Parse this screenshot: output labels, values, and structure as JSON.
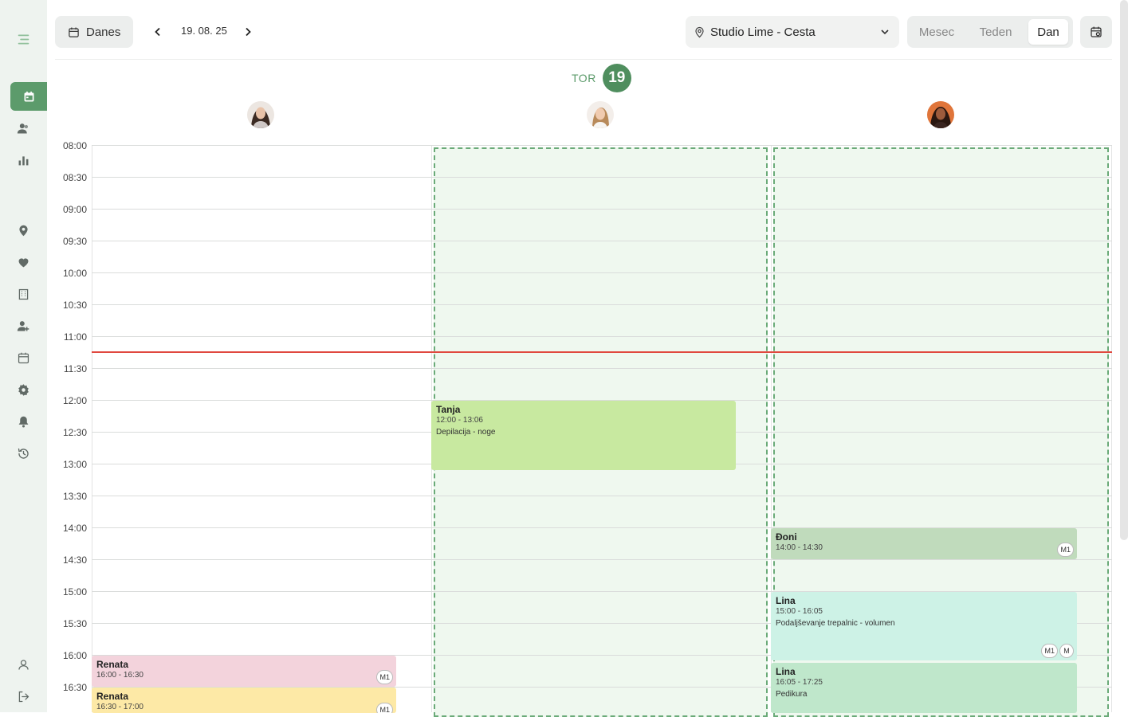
{
  "sidebar": {
    "icons": [
      "menu-icon",
      "calendar-icon",
      "clients-icon",
      "chart-icon",
      "location-icon",
      "services-icon",
      "building-icon",
      "add-user-icon",
      "schedule-icon",
      "settings-icon",
      "bell-icon",
      "history-icon",
      "profile-icon",
      "logout-icon"
    ]
  },
  "toolbar": {
    "today_label": "Danes",
    "date": "19. 08. 25",
    "location": "Studio Lime - Cesta",
    "views": [
      "Mesec",
      "Teden",
      "Dan"
    ],
    "active_view": "Dan"
  },
  "day": {
    "name": "TOR",
    "number": "19"
  },
  "times": [
    "08:00",
    "08:30",
    "09:00",
    "09:30",
    "10:00",
    "10:30",
    "11:00",
    "11:30",
    "12:00",
    "12:30",
    "13:00",
    "13:30",
    "14:00",
    "14:30",
    "15:00",
    "15:30",
    "16:00",
    "16:30"
  ],
  "events": [
    {
      "name": "Tanja",
      "time": "12:00 - 13:06",
      "service": "Depilacija - noge",
      "color": "#c8e9a0",
      "badges": []
    },
    {
      "name": "Đoni",
      "time": "14:00 - 14:30",
      "service": "",
      "color": "#c0dbbc",
      "badges": [
        "M1"
      ]
    },
    {
      "name": "Lina",
      "time": "15:00 - 16:05",
      "service": "Podaljševanje trepalnic - volumen",
      "color": "#cdf2e6",
      "badges": [
        "M1",
        "M"
      ]
    },
    {
      "name": "Lina",
      "time": "16:05 - 17:25",
      "service": "Pedikura",
      "color": "#bfe7cb",
      "badges": []
    },
    {
      "name": "Renata",
      "time": "16:00 - 16:30",
      "service": "",
      "color": "#f3d3dc",
      "badges": [
        "M1"
      ]
    },
    {
      "name": "Renata",
      "time": "16:30 - 17:00",
      "service": "",
      "color": "#fde9a6",
      "badges": [
        "M1"
      ]
    }
  ],
  "colors": {
    "accent": "#5c9b6b",
    "now_line": "#e0483f"
  }
}
